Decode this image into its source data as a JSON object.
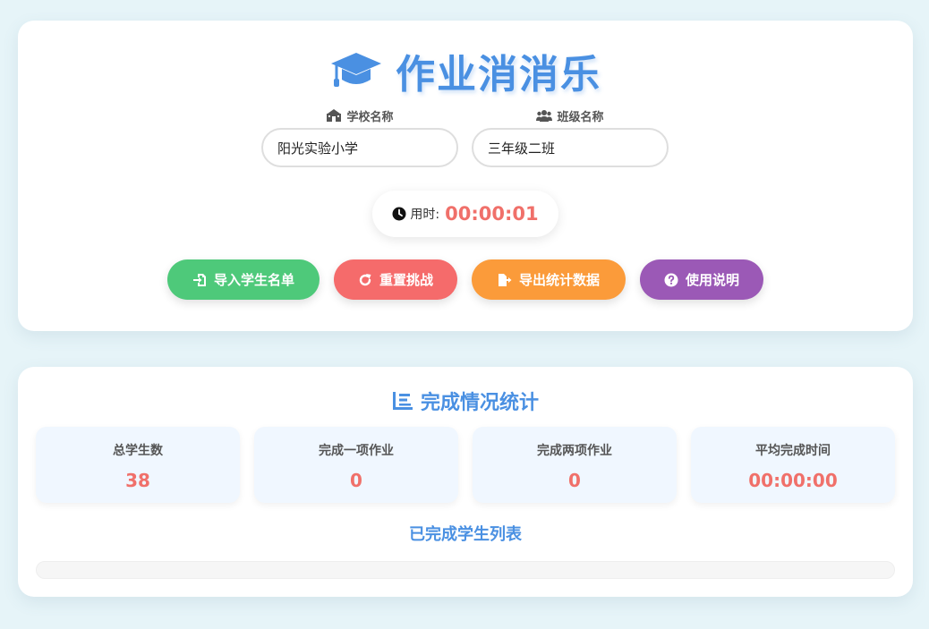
{
  "header": {
    "title": "作业消消乐",
    "icon": "graduation-cap-icon",
    "accent_color": "#4a90e2"
  },
  "school": {
    "label": "学校名称",
    "icon": "school-icon",
    "value": "阳光实验小学"
  },
  "class_field": {
    "label": "班级名称",
    "icon": "users-icon",
    "value": "三年级二班"
  },
  "timer": {
    "icon": "clock-icon",
    "label": "用时:",
    "value": "00:00:01"
  },
  "actions": {
    "import_label": "导入学生名单",
    "import_color": "#4ec97a",
    "reset_label": "重置挑战",
    "reset_color": "#f56b6b",
    "export_label": "导出统计数据",
    "export_color": "#fb9b3a",
    "help_label": "使用说明",
    "help_color": "#9b59b6"
  },
  "stats": {
    "title": "完成情况统计",
    "icon": "list-icon",
    "boxes": [
      {
        "label": "总学生数",
        "value": "38"
      },
      {
        "label": "完成一项作业",
        "value": "0"
      },
      {
        "label": "完成两项作业",
        "value": "0"
      },
      {
        "label": "平均完成时间",
        "value": "00:00:00"
      }
    ],
    "value_color": "#f0706a"
  },
  "completed": {
    "title": "已完成学生列表",
    "students": []
  }
}
